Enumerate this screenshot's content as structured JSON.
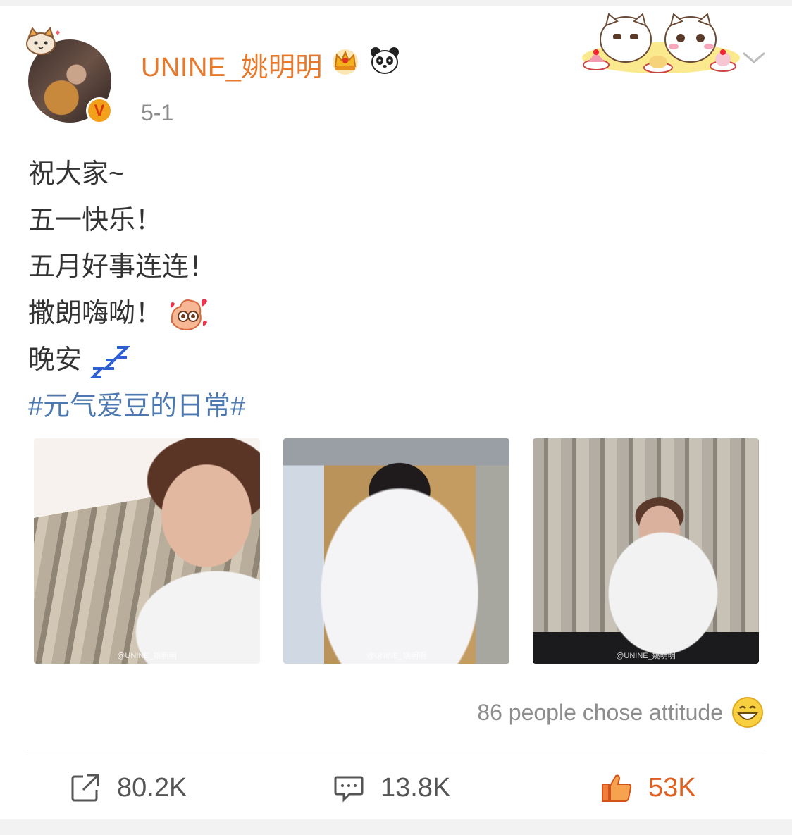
{
  "post": {
    "author": {
      "username": "UNINE_姚明明",
      "verified_mark": "V",
      "badges": [
        "crown-badge-icon",
        "panda-badge-icon"
      ]
    },
    "date": "5-1",
    "lines": [
      "祝大家~",
      "五一快乐！",
      "五月好事连连！",
      "撒朗嗨呦！",
      "晚安"
    ],
    "line_emojis": {
      "line4": "heart-hands-emoji",
      "line5": "zzz-emoji"
    },
    "hashtag": "#元气爱豆的日常#",
    "photos": [
      {
        "watermark": "@UNINE_姚明明",
        "alt_icon": "photo-1"
      },
      {
        "watermark": "@UNINE_姚明明",
        "alt_icon": "photo-2"
      },
      {
        "watermark": "@UNINE_姚明明",
        "alt_icon": "photo-3"
      }
    ],
    "attitude_text": "86 people chose attitude",
    "actions": {
      "share_count": "80.2K",
      "comment_count": "13.8K",
      "like_count": "53K"
    }
  },
  "colors": {
    "username": "#e7792c",
    "hashtag": "#4d79b0",
    "like": "#e06020",
    "verified": "#f3a01b"
  }
}
